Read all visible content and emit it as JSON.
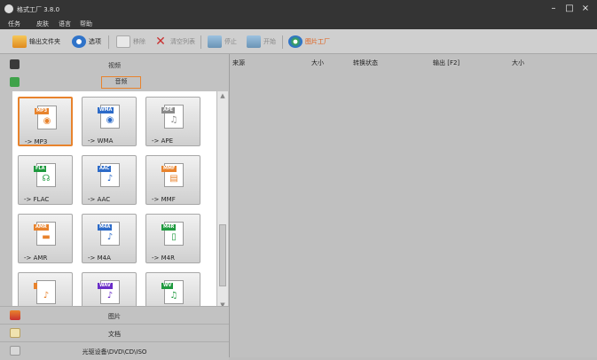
{
  "window": {
    "title": "格式工厂 3.8.0",
    "minimize": "–",
    "maximize": "□",
    "close": "×"
  },
  "menu": [
    "任务",
    "皮肤",
    "语言",
    "帮助"
  ],
  "toolbar": {
    "output_folder": "输出文件夹",
    "options": "选项",
    "remove": "移除",
    "clear_list": "清空列表",
    "stop": "停止",
    "start": "开始",
    "picture_factory": "图片工厂"
  },
  "sidebar": {
    "video_label": "视频",
    "audio_label": "音频",
    "picture_label": "图片",
    "document_label": "文档",
    "rom_label": "光驱设备\\DVD\\CD\\ISO"
  },
  "formats": [
    {
      "badge": "MP3",
      "label": "-> MP3",
      "color": "#e8832d",
      "glyph": "◉",
      "selected": true
    },
    {
      "badge": "WMA",
      "label": "-> WMA",
      "color": "#2d6bc8",
      "glyph": "◉",
      "selected": false
    },
    {
      "badge": "APE",
      "label": "-> APE",
      "color": "#8a8a8a",
      "glyph": "♫",
      "selected": false
    },
    {
      "badge": "FLA",
      "label": "-> FLAC",
      "color": "#1f9a3f",
      "glyph": "☊",
      "selected": false
    },
    {
      "badge": "AAC",
      "label": "-> AAC",
      "color": "#2d6bc8",
      "glyph": "♪",
      "selected": false
    },
    {
      "badge": "MMF",
      "label": "-> MMF",
      "color": "#e8832d",
      "glyph": "▤",
      "selected": false
    },
    {
      "badge": "AMR",
      "label": "-> AMR",
      "color": "#e8832d",
      "glyph": "▬",
      "selected": false
    },
    {
      "badge": "M4A",
      "label": "-> M4A",
      "color": "#2d6bc8",
      "glyph": "♪",
      "selected": false
    },
    {
      "badge": "M4R",
      "label": "-> M4R",
      "color": "#1f9a3f",
      "glyph": "▯",
      "selected": false
    },
    {
      "badge": "",
      "label": "",
      "color": "#e8832d",
      "glyph": "♪",
      "selected": false
    },
    {
      "badge": "WAV",
      "label": "",
      "color": "#6a2dc8",
      "glyph": "♪",
      "selected": false
    },
    {
      "badge": "WV",
      "label": "",
      "color": "#1f9a3f",
      "glyph": "♫",
      "selected": false
    }
  ],
  "list": {
    "col_source": "来源",
    "col_size": "大小",
    "col_status": "转换状态",
    "col_output": "输出 [F2]",
    "col_outsize": "大小"
  }
}
